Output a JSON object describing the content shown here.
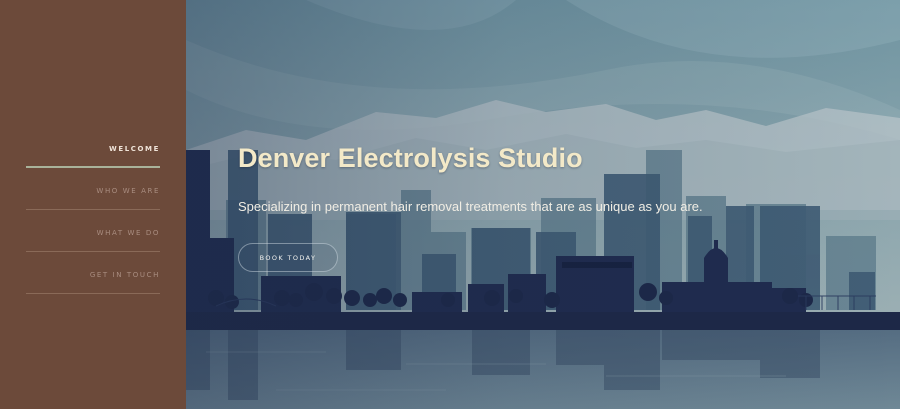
{
  "nav": {
    "items": [
      {
        "label": "WELCOME",
        "active": true
      },
      {
        "label": "WHO WE ARE",
        "active": false
      },
      {
        "label": "WHAT WE DO",
        "active": false
      },
      {
        "label": "GET IN TOUCH",
        "active": false
      }
    ]
  },
  "hero": {
    "title": "Denver Electrolysis Studio",
    "subtitle": "Specializing in permanent hair removal treatments that are as unique as you are.",
    "cta_label": "BOOK TODAY",
    "background": "denver-skyline-illustration"
  },
  "colors": {
    "sidebar": "#6c4a3a",
    "sky": "#7a9aa6",
    "skyline_dark": "#1f2b4e",
    "title": "#f3e9c8"
  }
}
